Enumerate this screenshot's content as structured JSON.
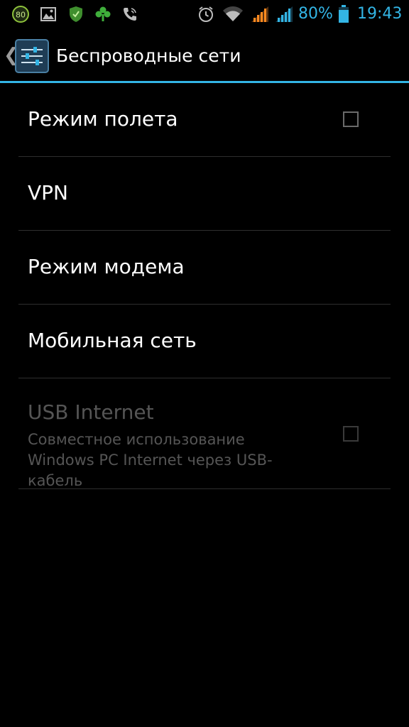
{
  "status_bar": {
    "notification_badge": "80",
    "battery_percent": "80%",
    "time": "19:43",
    "accent_color": "#33b5e5",
    "left_icons": [
      "badge-80-icon",
      "gallery-icon",
      "shield-icon",
      "clover-icon",
      "phone-call-icon"
    ],
    "right_icons": [
      "alarm-icon",
      "wifi-icon",
      "signal-icon",
      "signal-icon",
      "battery-icon"
    ]
  },
  "action_bar": {
    "title": "Беспроводные сети",
    "icon": "settings-sliders-icon",
    "divider_color": "#33b5e5"
  },
  "settings": {
    "airplane_mode": {
      "title": "Режим полета",
      "checked": false
    },
    "vpn": {
      "title": "VPN"
    },
    "tethering": {
      "title": "Режим модема"
    },
    "mobile_network": {
      "title": "Мобильная сеть"
    },
    "usb_internet": {
      "title": "USB Internet",
      "summary": "Совместное использование Windows PC Internet через USB-кабель",
      "enabled": false,
      "checked": false
    }
  }
}
